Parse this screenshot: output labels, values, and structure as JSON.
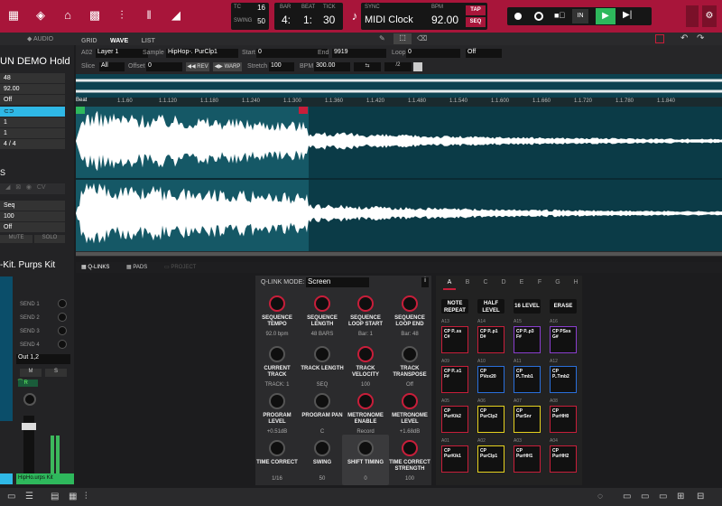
{
  "transport": {
    "tc_label": "TC",
    "tc": "16",
    "swing_label": "SWING",
    "swing": "50",
    "bar_label": "BAR",
    "bar": "4:",
    "beat_label": "BEAT",
    "beat": "1:",
    "tick_label": "TICK",
    "tick": "30",
    "sync_label": "SYNC",
    "sync": "MIDI Clock",
    "bpm_label": "BPM",
    "bpm": "92.00",
    "tap": "TAP",
    "seq": "SEQ"
  },
  "subbar": {
    "tabs": [
      "GRID",
      "WAVE",
      "LIST"
    ],
    "left_tab": "AUDIO"
  },
  "left": {
    "title": "UN DEMO Hold",
    "rows": [
      "48",
      "92.00",
      "Off",
      "",
      "1",
      "1",
      "4  /  4"
    ],
    "track_rows": [
      "Seq",
      "100",
      "Off"
    ],
    "mute": "MUTE",
    "solo": "SOLO",
    "kit": "-Kit. Purps Kit",
    "sends": [
      "SEND 1",
      "SEND 2",
      "SEND 3",
      "SEND 4"
    ],
    "out": "Out 1,2",
    "m": "M",
    "s": "S",
    "bottom_label": "HipHo.urps Kit"
  },
  "wave": {
    "a_label": "A02",
    "layer": "Layer 1",
    "sample_label": "Sample",
    "sample": "HipHop-. PurClp1",
    "start_label": "Start",
    "start": "0",
    "end_label": "End",
    "end": "9919",
    "loop_label": "Loop",
    "loop": "0",
    "loop_mode": "Off",
    "slice_label": "Slice",
    "slice": "All",
    "offset_label": "Offset",
    "offset": "0",
    "rev": "REV",
    "warp": "WARP",
    "stretch_label": "Stretch",
    "stretch": "100",
    "bpm_label": "BPM",
    "bpm": "300.00",
    "beat_label": "Beat",
    "ruler": [
      "1.1.60",
      "1.1.120",
      "1.1.180",
      "1.1.240",
      "1.1.300",
      "1.1.360",
      "1.1.420",
      "1.1.480",
      "1.1.540",
      "1.1.600",
      "1.1.660",
      "1.1.720",
      "1.1.780",
      "1.1.840"
    ]
  },
  "qlinks": {
    "tabs": [
      "Q-LINKS",
      "PADS",
      "PROJECT"
    ],
    "mode_label": "Q-LINK MODE:",
    "mode": "Screen",
    "knobs": [
      {
        "label": "SEQUENCE TEMPO",
        "value": "92.0 bpm",
        "red": true
      },
      {
        "label": "SEQUENCE LENGTH",
        "value": "48 BARS",
        "red": true
      },
      {
        "label": "SEQUENCE LOOP START",
        "value": "Bar: 1",
        "red": true
      },
      {
        "label": "SEQUENCE LOOP END",
        "value": "Bar: 48",
        "red": true
      },
      {
        "label": "CURRENT TRACK",
        "value": "TRACK: 1",
        "red": false
      },
      {
        "label": "TRACK LENGTH",
        "value": "SEQ",
        "red": false
      },
      {
        "label": "TRACK VELOCITY",
        "value": "100",
        "red": true
      },
      {
        "label": "TRACK TRANSPOSE",
        "value": "Off",
        "red": false
      },
      {
        "label": "PROGRAM LEVEL",
        "value": "+0.51dB",
        "red": false
      },
      {
        "label": "PROGRAM PAN",
        "value": "C",
        "red": false
      },
      {
        "label": "METRONOME ENABLE",
        "value": "Record",
        "red": true
      },
      {
        "label": "METRONOME LEVEL",
        "value": "+1.68dB",
        "red": true
      },
      {
        "label": "TIME CORRECT",
        "value": "1/16",
        "red": false
      },
      {
        "label": "SWING",
        "value": "50",
        "red": false
      },
      {
        "label": "SHIFT TIMING",
        "value": "0",
        "red": false
      },
      {
        "label": "TIME CORRECT STRENGTH",
        "value": "100",
        "red": true
      }
    ]
  },
  "pads": {
    "banks": [
      "A",
      "B",
      "C",
      "D",
      "E",
      "F",
      "G",
      "H"
    ],
    "buttons": [
      "NOTE REPEAT",
      "HALF LEVEL",
      "16 LEVEL",
      "ERASE"
    ],
    "rows": [
      [
        {
          "id": "A13",
          "name": "CP P..ss C#",
          "color": "#c81e3a"
        },
        {
          "id": "A14",
          "name": "CP P..p1 D#",
          "color": "#c81e3a"
        },
        {
          "id": "A15",
          "name": "CP P..p3 F#",
          "color": "#8a3ecf"
        },
        {
          "id": "A16",
          "name": "CP PSss G#",
          "color": "#8a3ecf"
        }
      ],
      [
        {
          "id": "A09",
          "name": "CP P..x1 F#",
          "color": "#c81e3a"
        },
        {
          "id": "A10",
          "name": "CP PVox20",
          "color": "#2a6fdb"
        },
        {
          "id": "A11",
          "name": "CP P..Tmb1",
          "color": "#2a6fdb"
        },
        {
          "id": "A12",
          "name": "CP P..Tmb2",
          "color": "#2a6fdb"
        }
      ],
      [
        {
          "id": "A05",
          "name": "CP PurKik2",
          "color": "#c81e3a"
        },
        {
          "id": "A06",
          "name": "CP PurClp2",
          "color": "#e6d21e"
        },
        {
          "id": "A07",
          "name": "CP PurSnr",
          "color": "#e6d21e"
        },
        {
          "id": "A08",
          "name": "CP PurHH0",
          "color": "#c81e3a"
        }
      ],
      [
        {
          "id": "A01",
          "name": "CP PurKik1",
          "color": "#c81e3a"
        },
        {
          "id": "A02",
          "name": "CP PurClp1",
          "color": "#e6d21e"
        },
        {
          "id": "A03",
          "name": "CP PurHH1",
          "color": "#c81e3a"
        },
        {
          "id": "A04",
          "name": "CP PurHH2",
          "color": "#c81e3a"
        }
      ]
    ]
  }
}
